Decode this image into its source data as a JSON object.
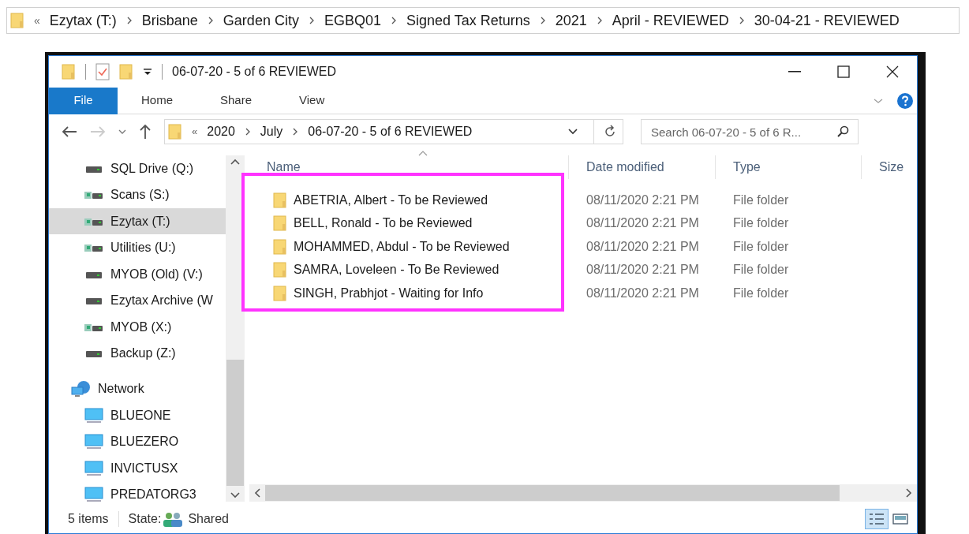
{
  "top_breadcrumb": {
    "overflow": "«",
    "segments": [
      "Ezytax (T:)",
      "Brisbane",
      "Garden City",
      "EGBQ01",
      "Signed Tax Returns",
      "2021",
      "April - REVIEWED",
      "30-04-21 - REVIEWED"
    ]
  },
  "window": {
    "title": "06-07-20 - 5 of 6 REVIEWED"
  },
  "ribbon_tabs": [
    {
      "label": "File",
      "selected": true
    },
    {
      "label": "Home",
      "selected": false
    },
    {
      "label": "Share",
      "selected": false
    },
    {
      "label": "View",
      "selected": false
    }
  ],
  "address_bar": {
    "overflow": "«",
    "segments": [
      "2020",
      "July",
      "06-07-20 - 5 of 6 REVIEWED"
    ]
  },
  "search": {
    "placeholder": "Search 06-07-20 - 5 of 6 R..."
  },
  "nav_items": [
    {
      "kind": "drive",
      "label": "SQL Drive (Q:)",
      "selected": false
    },
    {
      "kind": "network-drive",
      "label": "Scans (S:)",
      "selected": false
    },
    {
      "kind": "network-drive",
      "label": "Ezytax (T:)",
      "selected": true
    },
    {
      "kind": "network-drive",
      "label": "Utilities (U:)",
      "selected": false
    },
    {
      "kind": "drive",
      "label": "MYOB (Old) (V:)",
      "selected": false
    },
    {
      "kind": "drive",
      "label": "Ezytax Archive (W",
      "selected": false
    },
    {
      "kind": "network-drive",
      "label": "MYOB (X:)",
      "selected": false
    },
    {
      "kind": "drive",
      "label": "Backup (Z:)",
      "selected": false
    },
    {
      "kind": "network",
      "label": "Network",
      "selected": false,
      "children": [
        {
          "kind": "computer",
          "label": "BLUEONE",
          "selected": false
        },
        {
          "kind": "computer",
          "label": "BLUEZERO",
          "selected": false
        },
        {
          "kind": "computer",
          "label": "INVICTUSX",
          "selected": false
        },
        {
          "kind": "computer",
          "label": "PREDATORG3",
          "selected": false
        }
      ]
    }
  ],
  "table": {
    "columns": [
      "Name",
      "Date modified",
      "Type",
      "Size"
    ],
    "rows": [
      {
        "name": "ABETRIA, Albert - To be Reviewed",
        "date": "08/11/2020 2:21 PM",
        "type": "File folder"
      },
      {
        "name": "BELL, Ronald - To be Reviewed",
        "date": "08/11/2020 2:21 PM",
        "type": "File folder"
      },
      {
        "name": "MOHAMMED, Abdul - To be Reviewed",
        "date": "08/11/2020 2:21 PM",
        "type": "File folder"
      },
      {
        "name": "SAMRA, Loveleen - To Be Reviewed",
        "date": "08/11/2020 2:21 PM",
        "type": "File folder"
      },
      {
        "name": "SINGH, Prabhjot - Waiting for Info",
        "date": "08/11/2020 2:21 PM",
        "type": "File folder"
      }
    ]
  },
  "status_bar": {
    "count": "5 items",
    "state_label": "State:",
    "state_value": "Shared"
  }
}
